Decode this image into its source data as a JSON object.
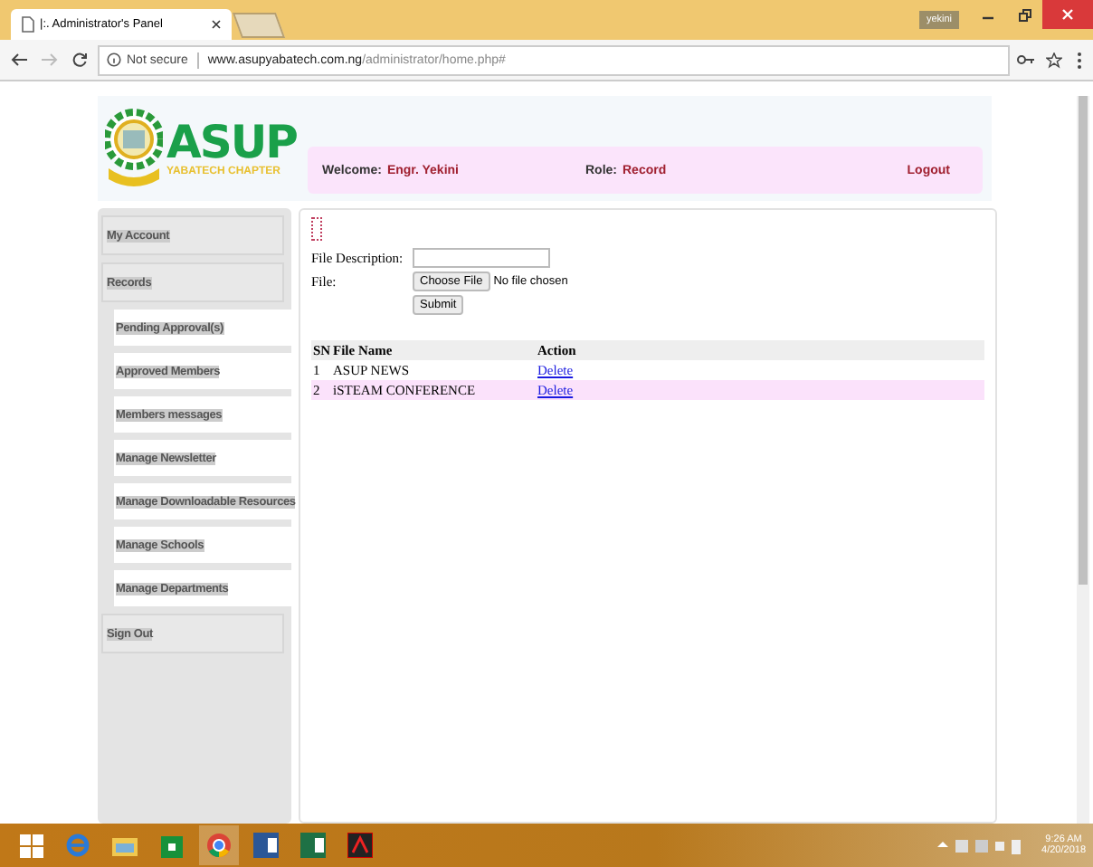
{
  "browser": {
    "tab_title": "|:. Administrator's Panel",
    "user_badge": "yekini",
    "security": "Not secure",
    "url_host": "www.asupyabatech.com.ng",
    "url_path": "/administrator/home.php#"
  },
  "logo": {
    "title": "ASUP",
    "subtitle": "YABATECH CHAPTER"
  },
  "header": {
    "welcome_label": "Welcome:",
    "welcome_name": "Engr. Yekini",
    "role_label": "Role:",
    "role_value": "Record",
    "logout": "Logout"
  },
  "sidebar": {
    "items": [
      {
        "label": "My Account",
        "kind": "section"
      },
      {
        "label": "Records",
        "kind": "section"
      },
      {
        "label": "Pending Approval(s)",
        "kind": "sub"
      },
      {
        "label": "Approved Members",
        "kind": "sub"
      },
      {
        "label": "Members messages",
        "kind": "sub"
      },
      {
        "label": "Manage Newsletter",
        "kind": "sub"
      },
      {
        "label": "Manage Downloadable Resources",
        "kind": "sub"
      },
      {
        "label": "Manage Schools",
        "kind": "sub"
      },
      {
        "label": "Manage Departments",
        "kind": "sub"
      },
      {
        "label": "Sign Out",
        "kind": "section"
      }
    ]
  },
  "form": {
    "description_label": "File Description:",
    "file_label": "File:",
    "choose_button": "Choose File",
    "no_file": "No file chosen",
    "submit": "Submit"
  },
  "table": {
    "columns": [
      "SN",
      "File Name",
      "Action"
    ],
    "rows": [
      {
        "sn": "1",
        "name": "ASUP NEWS",
        "action": "Delete",
        "highlighted": false
      },
      {
        "sn": "2",
        "name": "iSTEAM CONFERENCE",
        "action": "Delete",
        "highlighted": true
      }
    ]
  },
  "taskbar": {
    "time": "9:26 AM",
    "date": "4/20/2018"
  }
}
